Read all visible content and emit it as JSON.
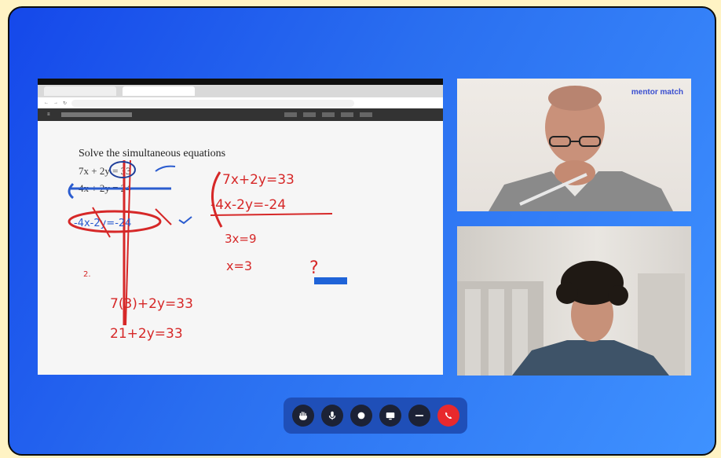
{
  "share": {
    "tabs": [
      "",
      ""
    ],
    "problem_text": "Solve the simultaneous equations",
    "equations": {
      "eq1": "7x+2y=33",
      "eq2": "-4x-2y=-24",
      "sum": "3x=9",
      "x": "x=3",
      "sub1": "7(3)+2y=33",
      "sub2": "21+2y=33",
      "q": "?",
      "note": "2."
    }
  },
  "mentor_tile": {
    "brand": "mentor match"
  },
  "controls": {
    "buttons": [
      {
        "name": "hand",
        "icon": "raise-hand-icon"
      },
      {
        "name": "mic",
        "icon": "microphone-icon"
      },
      {
        "name": "camera",
        "icon": "camera-icon"
      },
      {
        "name": "screen",
        "icon": "screen-share-icon"
      },
      {
        "name": "more",
        "icon": "more-icon"
      },
      {
        "name": "end",
        "icon": "end-call-icon"
      }
    ],
    "colors": {
      "bar": "#1f4fb8",
      "button": "#1c2236",
      "end": "#e8292d"
    }
  }
}
